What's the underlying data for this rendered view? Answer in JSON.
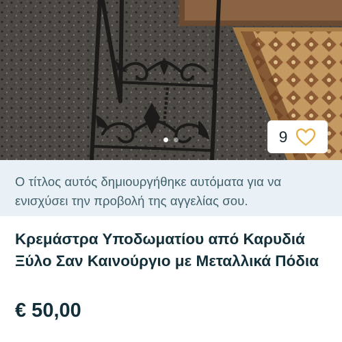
{
  "listing": {
    "photo": {
      "alt": "",
      "current_index": 1,
      "total": 2
    },
    "favorites": {
      "count": "9",
      "icon": "heart-outline-icon",
      "accent": "#e3b04a"
    },
    "auto_title_notice": "Ο τίτλος αυτός δημιουργήθηκε αυτόματα για να ενισχύσει την προβολή της αγγελίας σου.",
    "title": "Κρεμάστρα Υποδωματίου από Καρυδιά Ξύλο Σαν Καινούργιο με Μεταλλικά Πόδια",
    "price": "€ 50,00"
  },
  "colors": {
    "text_primary": "#13303a",
    "notice_bg": "#e9f1f6",
    "notice_text": "#40606c"
  }
}
